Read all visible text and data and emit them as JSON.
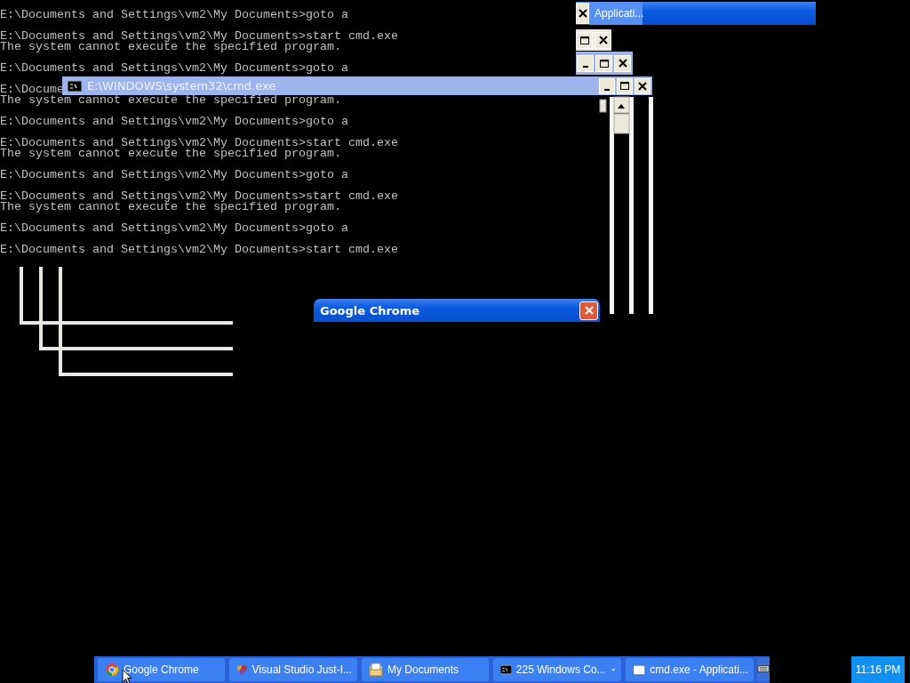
{
  "console": {
    "blocks": [
      [
        "E:\\Documents and Settings\\vm2\\My Documents>goto a"
      ],
      [
        "E:\\Documents and Settings\\vm2\\My Documents>start cmd.exe",
        "The system cannot execute the specified program."
      ],
      [
        "E:\\Documents and Settings\\vm2\\My Documents>goto a"
      ],
      [
        "E:\\Docume",
        "The system cannot execute the specified program."
      ],
      [
        "E:\\Documents and Settings\\vm2\\My Documents>goto a"
      ],
      [
        "E:\\Documents and Settings\\vm2\\My Documents>start cmd.exe",
        "The system cannot execute the specified program."
      ],
      [
        "E:\\Documents and Settings\\vm2\\My Documents>goto a"
      ],
      [
        "E:\\Documents and Settings\\vm2\\My Documents>start cmd.exe",
        "The system cannot execute the specified program."
      ],
      [
        "E:\\Documents and Settings\\vm2\\My Documents>goto a"
      ],
      [
        "E:\\Documents and Settings\\vm2\\My Documents>start cmd.exe"
      ]
    ]
  },
  "windows": [
    {
      "title": "Applicati...",
      "active": true,
      "buttons": [
        {
          "kind": "close"
        }
      ]
    },
    {
      "buttons": [
        {
          "kind": "maximize"
        },
        {
          "kind": "close"
        }
      ]
    },
    {
      "active": false,
      "buttons": [
        {
          "kind": "minimize"
        },
        {
          "kind": "maximize"
        },
        {
          "kind": "close"
        }
      ]
    },
    {
      "title": "E:\\WINDOWS\\system32\\cmd.exe",
      "active": false,
      "buttons": [
        {
          "kind": "minimize"
        },
        {
          "kind": "maximize"
        },
        {
          "kind": "close"
        }
      ]
    },
    {
      "title": "Google Chrome",
      "active": true,
      "buttons": [
        {
          "kind": "close"
        }
      ]
    }
  ],
  "taskbar": {
    "items": [
      {
        "label": "Google Chrome",
        "kind": "button"
      },
      {
        "label": "Visual Studio Just-I...",
        "kind": "button"
      },
      {
        "label": "My Documents",
        "kind": "button"
      },
      {
        "label": "225 Windows Co...",
        "kind": "group"
      },
      {
        "label": "cmd.exe - Applicati...",
        "kind": "button"
      }
    ],
    "clock": "11:16 PM"
  }
}
